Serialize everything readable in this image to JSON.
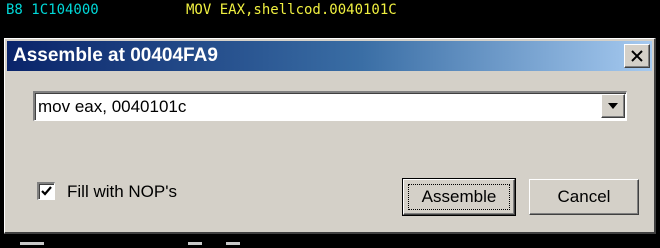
{
  "disassembly": {
    "bytes": "B8 1C104000",
    "instruction": "MOV EAX,shellcod.0040101C"
  },
  "dialog": {
    "title": "Assemble at 00404FA9",
    "close_icon": "close-icon",
    "combo": {
      "value": "mov eax, 0040101c",
      "arrow_icon": "chevron-down-icon"
    },
    "checkbox": {
      "label": "Fill with NOP's",
      "checked": true
    },
    "buttons": {
      "assemble_label": "Assemble",
      "cancel_label": "Cancel"
    }
  },
  "colors": {
    "titlebar_start": "#0a246a",
    "titlebar_end": "#a6caf0",
    "dialog_face": "#d4d0c8",
    "disasm_bytes": "#00d8d8",
    "disasm_instruction": "#f0f040"
  }
}
